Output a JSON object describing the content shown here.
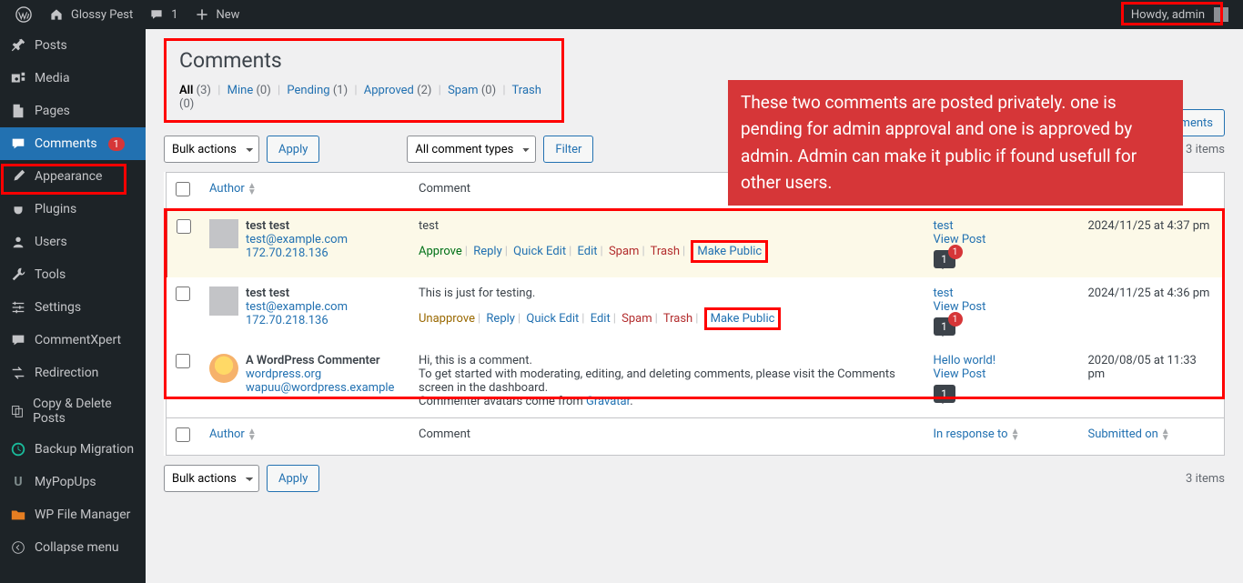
{
  "adminbar": {
    "site_title": "Glossy Pest",
    "comment_count": "1",
    "new_label": "New",
    "howdy": "Howdy, admin"
  },
  "sidebar": {
    "items": [
      {
        "label": "Posts"
      },
      {
        "label": "Media"
      },
      {
        "label": "Pages"
      },
      {
        "label": "Comments",
        "badge": "1"
      },
      {
        "label": "Appearance"
      },
      {
        "label": "Plugins"
      },
      {
        "label": "Users"
      },
      {
        "label": "Tools"
      },
      {
        "label": "Settings"
      },
      {
        "label": "CommentXpert"
      },
      {
        "label": "Redirection"
      },
      {
        "label": "Copy & Delete Posts"
      },
      {
        "label": "Backup Migration"
      },
      {
        "label": "MyPopUps"
      },
      {
        "label": "WP File Manager"
      },
      {
        "label": "Collapse menu"
      }
    ]
  },
  "page": {
    "title": "Comments",
    "filters": {
      "all": "All",
      "all_count": "(3)",
      "mine": "Mine",
      "mine_count": "(0)",
      "pending": "Pending",
      "pending_count": "(1)",
      "approved": "Approved",
      "approved_count": "(2)",
      "spam": "Spam",
      "spam_count": "(0)",
      "trash": "Trash",
      "trash_count": "(0)"
    },
    "bulk_actions": "Bulk actions",
    "apply": "Apply",
    "comment_types": "All comment types",
    "filter": "Filter",
    "items_count": "3 items",
    "search_btn": "Search Comments"
  },
  "callout": "These two comments are posted privately. one is pending for admin approval and one is approved by admin. Admin can make it public if found usefull for other users.",
  "table": {
    "cols": {
      "author": "Author",
      "comment": "Comment",
      "response": "In response to",
      "date": "Submitted on"
    },
    "actions": {
      "approve": "Approve",
      "unapprove": "Unapprove",
      "reply": "Reply",
      "quick_edit": "Quick Edit",
      "edit": "Edit",
      "spam": "Spam",
      "trash": "Trash",
      "make_public": "Make Public"
    }
  },
  "comments": [
    {
      "status": "unapproved",
      "author_name": "test test",
      "author_email": "test@example.com",
      "author_ip": "172.70.218.136",
      "content": "test",
      "response_title": "test",
      "response_view": "View Post",
      "bubble": "1",
      "bubble_badge": "1",
      "date": "2024/11/25 at 4:37 pm"
    },
    {
      "status": "approved",
      "author_name": "test test",
      "author_email": "test@example.com",
      "author_ip": "172.70.218.136",
      "content": "This is just for testing.",
      "response_title": "test",
      "response_view": "View Post",
      "bubble": "1",
      "bubble_badge": "1",
      "date": "2024/11/25 at 4:36 pm"
    },
    {
      "status": "approved",
      "author_name": "A WordPress Commenter",
      "author_url": "wordpress.org",
      "author_email": "wapuu@wordpress.example",
      "content_l1": "Hi, this is a comment.",
      "content_l2": "To get started with moderating, editing, and deleting comments, please visit the Comments screen in the dashboard.",
      "content_l3a": "Commenter avatars come from ",
      "content_l3b": "Gravatar",
      "content_l3c": ".",
      "response_title": "Hello world!",
      "response_view": "View Post",
      "bubble": "1",
      "date": "2020/08/05 at 11:33 pm"
    }
  ]
}
